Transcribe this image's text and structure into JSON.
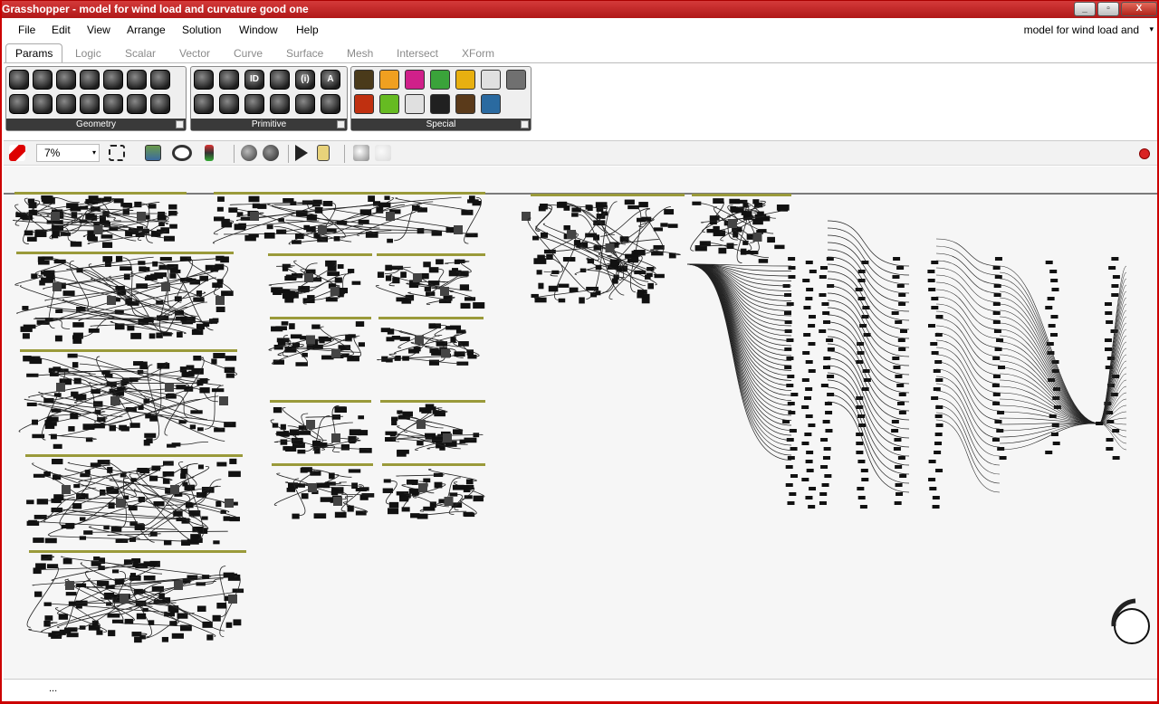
{
  "window": {
    "title": "Grasshopper - model for wind load and curvature good one",
    "minimize": "_",
    "maximize": "▫",
    "close": "X"
  },
  "menu": {
    "items": [
      "File",
      "Edit",
      "View",
      "Arrange",
      "Solution",
      "Window",
      "Help"
    ],
    "document_title": "model for wind load and",
    "document_dropdown": "▾"
  },
  "tabs": [
    "Params",
    "Logic",
    "Scalar",
    "Vector",
    "Curve",
    "Surface",
    "Mesh",
    "Intersect",
    "XForm"
  ],
  "active_tab": "Params",
  "ribbon": {
    "panels": [
      {
        "label": "Geometry",
        "icon_glyphs": [
          "",
          "",
          "",
          "",
          "",
          "",
          "",
          "",
          "",
          "",
          "",
          "",
          "",
          ""
        ]
      },
      {
        "label": "Primitive",
        "icon_glyphs": [
          "",
          "",
          "ID",
          "",
          "(i)",
          "A",
          "",
          "",
          "",
          "",
          "",
          ""
        ]
      },
      {
        "label": "Special",
        "icon_count": 14
      }
    ],
    "special_colors": [
      "#4a3a1a",
      "#f0a020",
      "#d0208a",
      "#3aa33a",
      "#e8b010",
      "#e0e0e0",
      "#707070",
      "#c03010",
      "#66bb22",
      "#e0e0e0",
      "#202020",
      "#5a3a1a",
      "#2a6aa0"
    ]
  },
  "toolbar": {
    "zoom": "7%",
    "zoom_dropdown": "▾",
    "record_color": "#d92323"
  },
  "statusbar": {
    "text": "..."
  }
}
